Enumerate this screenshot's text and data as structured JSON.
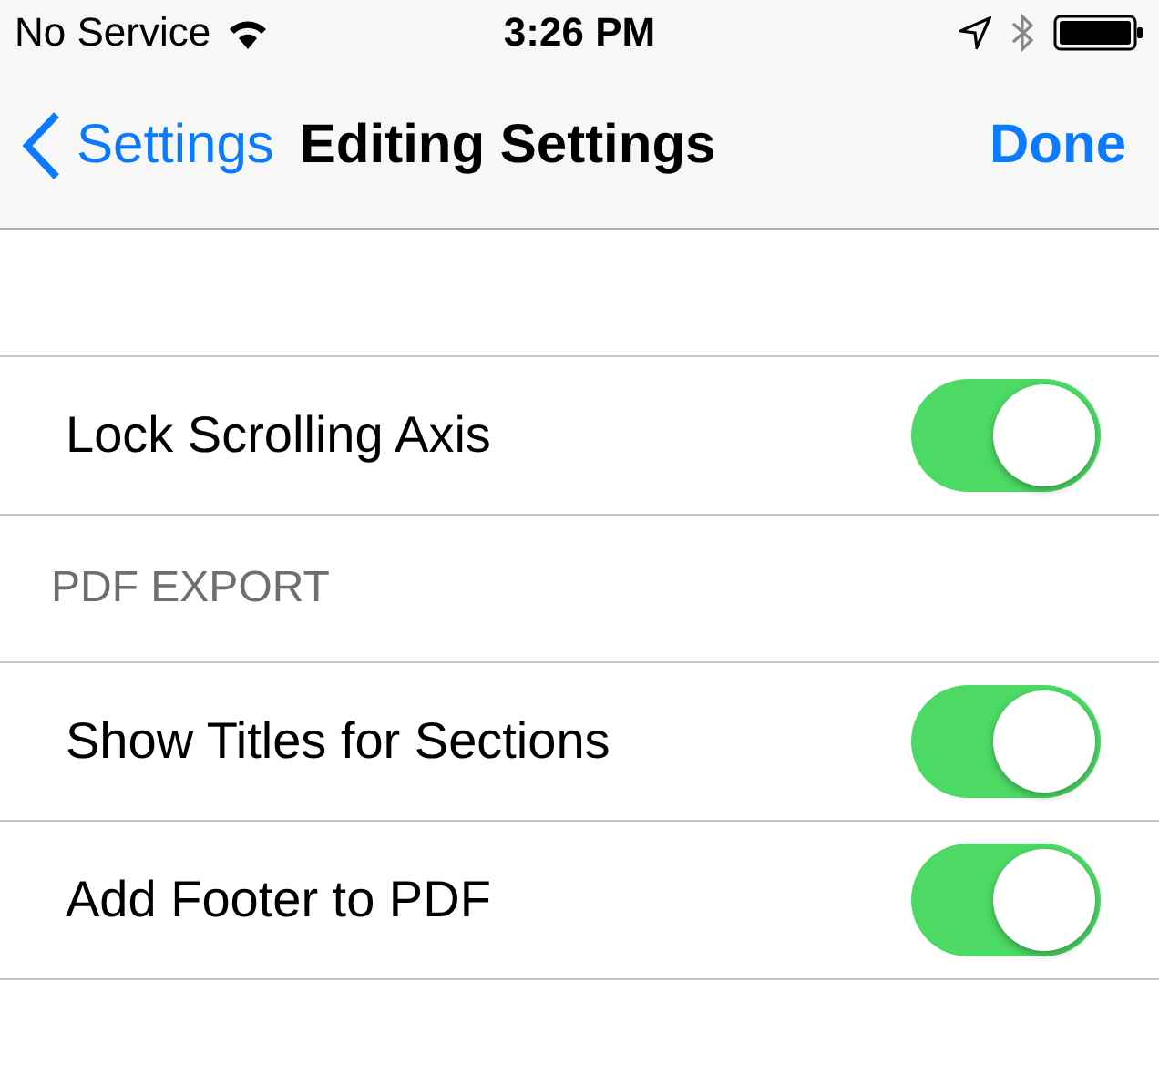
{
  "status_bar": {
    "carrier": "No Service",
    "time": "3:26 PM"
  },
  "nav": {
    "back": "Settings",
    "title": "Editing Settings",
    "action": "Done"
  },
  "sections": [
    {
      "rows": [
        {
          "label": "Lock Scrolling Axis",
          "on": true
        }
      ]
    },
    {
      "header": "PDF EXPORT",
      "rows": [
        {
          "label": "Show Titles for Sections",
          "on": true
        },
        {
          "label": "Add Footer to PDF",
          "on": true
        }
      ]
    }
  ]
}
